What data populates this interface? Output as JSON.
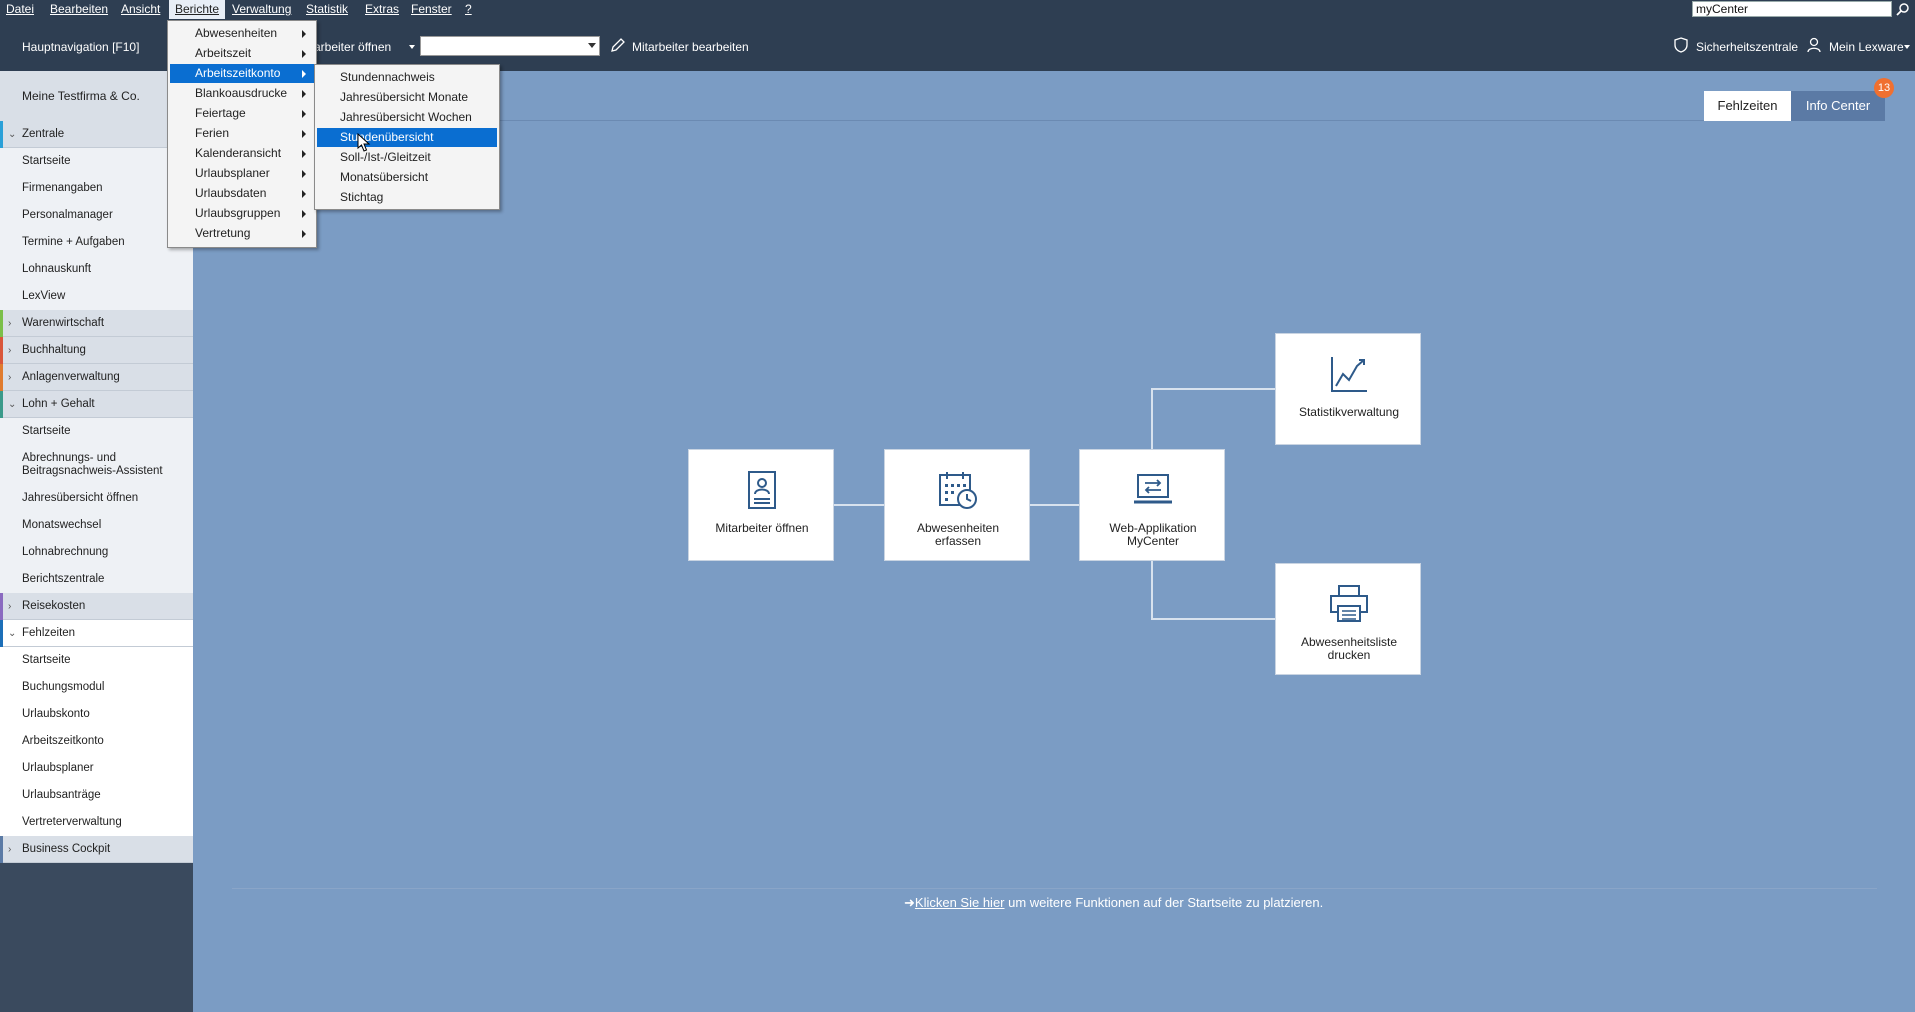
{
  "menubar": {
    "items": [
      "Datei",
      "Bearbeiten",
      "Ansicht",
      "Berichte",
      "Verwaltung",
      "Statistik",
      "Extras",
      "Fenster",
      "?"
    ],
    "search_value": "myCenter"
  },
  "toolbar": {
    "nav_label": "Hauptnavigation [F10]",
    "open_employee": "Mitarbeiter öffnen",
    "edit_employee": "Mitarbeiter bearbeiten",
    "security": "Sicherheitszentrale",
    "my_lexware": "Mein Lexware"
  },
  "sidebar": {
    "company": "Meine Testfirma & Co.",
    "items": [
      {
        "label": "Zentrale",
        "kind": "group",
        "open": true
      },
      {
        "label": "Startseite",
        "kind": "sub"
      },
      {
        "label": "Firmenangaben",
        "kind": "sub"
      },
      {
        "label": "Personalmanager",
        "kind": "sub"
      },
      {
        "label": "Termine + Aufgaben",
        "kind": "sub"
      },
      {
        "label": "Lohnauskunft",
        "kind": "sub"
      },
      {
        "label": "LexView",
        "kind": "sub"
      },
      {
        "label": "Warenwirtschaft",
        "kind": "group",
        "open": false
      },
      {
        "label": "Buchhaltung",
        "kind": "group",
        "open": false
      },
      {
        "label": "Anlagenverwaltung",
        "kind": "group",
        "open": false
      },
      {
        "label": "Lohn + Gehalt",
        "kind": "group",
        "open": true
      },
      {
        "label": "Startseite",
        "kind": "sub"
      },
      {
        "label": "Abrechnungs- und Beitragsnachweis-Assistent",
        "kind": "sub"
      },
      {
        "label": "Jahresübersicht öffnen",
        "kind": "sub"
      },
      {
        "label": "Monatswechsel",
        "kind": "sub"
      },
      {
        "label": "Lohnabrechnung",
        "kind": "sub"
      },
      {
        "label": "Berichtszentrale",
        "kind": "sub"
      },
      {
        "label": "Reisekosten",
        "kind": "group",
        "open": false
      },
      {
        "label": "Fehlzeiten",
        "kind": "group",
        "open": true
      },
      {
        "label": "Startseite",
        "kind": "sub"
      },
      {
        "label": "Buchungsmodul",
        "kind": "sub"
      },
      {
        "label": "Urlaubskonto",
        "kind": "sub"
      },
      {
        "label": "Arbeitszeitkonto",
        "kind": "sub"
      },
      {
        "label": "Urlaubsplaner",
        "kind": "sub"
      },
      {
        "label": "Urlaubsanträge",
        "kind": "sub"
      },
      {
        "label": "Vertreterverwaltung",
        "kind": "sub"
      },
      {
        "label": "Business Cockpit",
        "kind": "group",
        "open": false
      }
    ]
  },
  "tabs": {
    "active": "Fehlzeiten",
    "other": "Info Center",
    "badge": "13"
  },
  "tiles": {
    "employee": "Mitarbeiter öffnen",
    "absence": "Abwesenheiten erfassen",
    "webapp": "Web-Applikation MyCenter",
    "stats": "Statistikverwaltung",
    "print": "Abwesenheitsliste drucken"
  },
  "footer": {
    "arrow": "➜",
    "link": "Klicken Sie hier",
    "text": " um weitere Funktionen auf der Startseite zu platzieren."
  },
  "menu_berichte": [
    "Abwesenheiten",
    "Arbeitszeit",
    "Arbeitszeitkonto",
    "Blankoausdrucke",
    "Feiertage",
    "Ferien",
    "Kalenderansicht",
    "Urlaubsplaner",
    "Urlaubsdaten",
    "Urlaubsgruppen",
    "Vertretung"
  ],
  "menu_arbeitszeitkonto": [
    "Stundennachweis",
    "Jahresübersicht Monate",
    "Jahresübersicht Wochen",
    "Stundenübersicht",
    "Soll-/Ist-/Gleitzeit",
    "Monatsübersicht",
    "Stichtag"
  ],
  "highlight": {
    "berichte_index": 2,
    "submenu_index": 3
  },
  "colors": {
    "accent": "#0a6ed1",
    "dark": "#2e3e52",
    "canvas": "#7b9cc4",
    "badge": "#f07030"
  }
}
